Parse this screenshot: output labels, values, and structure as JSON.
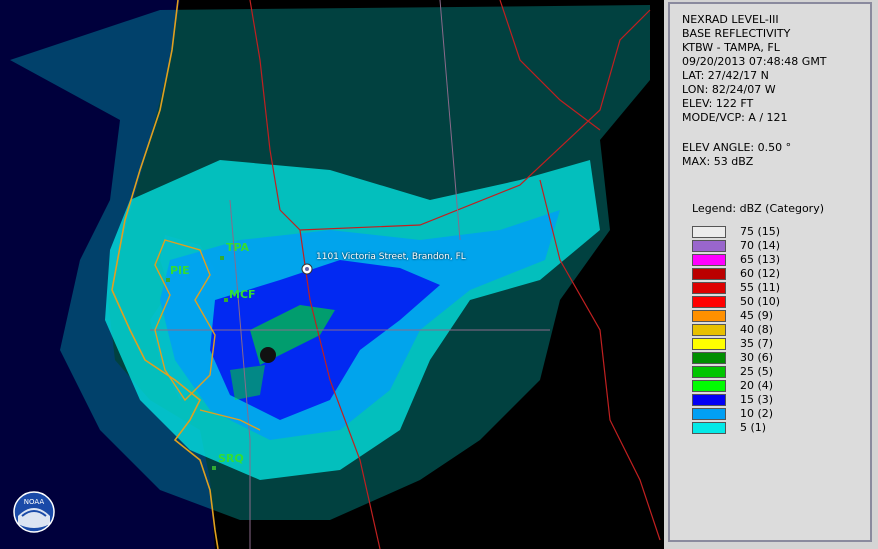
{
  "panel": {
    "lines": [
      "NEXRAD LEVEL-III",
      "BASE REFLECTIVITY",
      "KTBW - TAMPA, FL",
      "09/20/2013 07:48:48 GMT",
      "LAT: 27/42/17 N",
      "LON: 82/24/07 W",
      "ELEV: 122 FT",
      "MODE/VCP: A / 121"
    ],
    "elev_angle": "ELEV ANGLE: 0.50 °",
    "max": "MAX: 53 dBZ",
    "legend_title": "Legend: dBZ (Category)",
    "legend": [
      {
        "label": "75  (15)",
        "color": "#ececec"
      },
      {
        "label": "70  (14)",
        "color": "#9966cc"
      },
      {
        "label": "65  (13)",
        "color": "#ff00ff"
      },
      {
        "label": "60  (12)",
        "color": "#bb0000"
      },
      {
        "label": "55  (11)",
        "color": "#dd0000"
      },
      {
        "label": "50  (10)",
        "color": "#ff0000"
      },
      {
        "label": "45  (9)",
        "color": "#ff9000"
      },
      {
        "label": "40  (8)",
        "color": "#e7c000"
      },
      {
        "label": "35  (7)",
        "color": "#ffff00"
      },
      {
        "label": "30  (6)",
        "color": "#008e00"
      },
      {
        "label": "25  (5)",
        "color": "#01c501"
      },
      {
        "label": "20  (4)",
        "color": "#02fd02"
      },
      {
        "label": "15  (3)",
        "color": "#0300f4"
      },
      {
        "label": "10  (2)",
        "color": "#019ff4"
      },
      {
        "label": "5  (1)",
        "color": "#04e9e7"
      }
    ]
  },
  "map": {
    "sites": [
      "TPA",
      "PIE",
      "MCF",
      "SRQ"
    ],
    "marker_label": "1101 Victoria Street, Brandon, FL",
    "logo": "NOAA"
  },
  "colors": {
    "background": "#000000",
    "water": "#00003c",
    "coastline": "#e0a020",
    "roads": "#c02020",
    "county_lines": "#8a6a8a"
  }
}
